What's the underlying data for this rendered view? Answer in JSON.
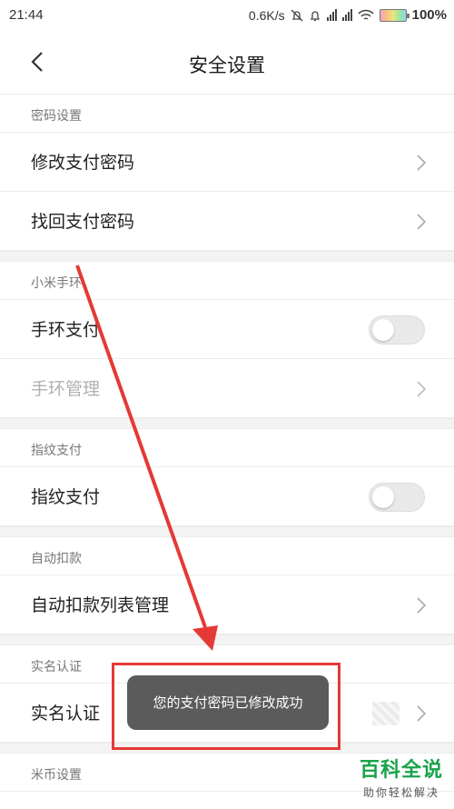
{
  "status_bar": {
    "time": "21:44",
    "speed": "0.6K/s",
    "battery": "100%"
  },
  "header": {
    "title": "安全设置"
  },
  "sections": {
    "password": {
      "header": "密码设置",
      "change_pay": "修改支付密码",
      "recover_pay": "找回支付密码"
    },
    "band": {
      "header": "小米手环",
      "band_pay": "手环支付",
      "band_manage": "手环管理"
    },
    "fingerprint": {
      "header": "指纹支付",
      "fingerprint_pay": "指纹支付"
    },
    "autodebit": {
      "header": "自动扣款",
      "autodebit_list": "自动扣款列表管理"
    },
    "realname": {
      "header": "实名认证",
      "realname_label": "实名认证"
    },
    "micoin": {
      "header": "米币设置"
    }
  },
  "toggles": {
    "band_pay": false,
    "fingerprint_pay": false
  },
  "toast": {
    "message": "您的支付密码已修改成功"
  },
  "watermark": {
    "title": "百科全说",
    "subtitle": "助你轻松解决"
  },
  "colors": {
    "annotation": "#e53935",
    "toast_bg": "#5b5b5b",
    "watermark": "#18a34a"
  }
}
